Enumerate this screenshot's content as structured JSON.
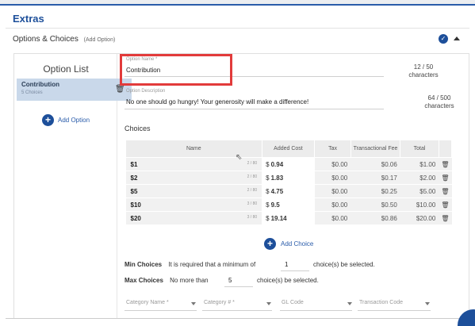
{
  "section": {
    "title": "Extras"
  },
  "options_header": {
    "title": "Options & Choices",
    "add_link": "(Add Option)"
  },
  "option_list": {
    "title": "Option List",
    "items": [
      {
        "name": "Contribution",
        "sub": "5 Choices"
      }
    ],
    "add_label": "Add Option"
  },
  "option_name": {
    "label": "Option Name *",
    "value": "Contribution",
    "counter": "12 / 50",
    "counter_unit": "characters"
  },
  "option_description": {
    "label": "Option Description",
    "value": "No one should go hungry! Your generosity will make a difference!",
    "counter": "64 / 500",
    "counter_unit": "characters"
  },
  "choices": {
    "title": "Choices",
    "columns": [
      "Name",
      "Added Cost",
      "Tax",
      "Transactional Fee",
      "Total"
    ],
    "rows": [
      {
        "name": "$1",
        "chars": "2 / 80",
        "cost": "0.94",
        "tax": "$0.00",
        "fee": "$0.06",
        "total": "$1.00"
      },
      {
        "name": "$2",
        "chars": "2 / 80",
        "cost": "1.83",
        "tax": "$0.00",
        "fee": "$0.17",
        "total": "$2.00"
      },
      {
        "name": "$5",
        "chars": "2 / 80",
        "cost": "4.75",
        "tax": "$0.00",
        "fee": "$0.25",
        "total": "$5.00"
      },
      {
        "name": "$10",
        "chars": "3 / 80",
        "cost": "9.5",
        "tax": "$0.00",
        "fee": "$0.50",
        "total": "$10.00"
      },
      {
        "name": "$20",
        "chars": "3 / 80",
        "cost": "19.14",
        "tax": "$0.00",
        "fee": "$0.86",
        "total": "$20.00"
      }
    ],
    "currency": "$",
    "add_label": "Add Choice"
  },
  "min_choices": {
    "label": "Min Choices",
    "prefix": "It is required that a minimum of",
    "value": "1",
    "suffix": "choice(s) be selected."
  },
  "max_choices": {
    "label": "Max Choices",
    "prefix": "No more than",
    "value": "5",
    "suffix": "choice(s) be selected."
  },
  "dropdowns": {
    "category_name": "Category Name *",
    "category_num": "Category # *",
    "gl_code": "GL Code",
    "transaction_code": "Transaction Code"
  },
  "colors": {
    "accent": "#1d4f9a",
    "highlight_box": "#e23b3b",
    "selected_item": "#c9d8ea"
  }
}
